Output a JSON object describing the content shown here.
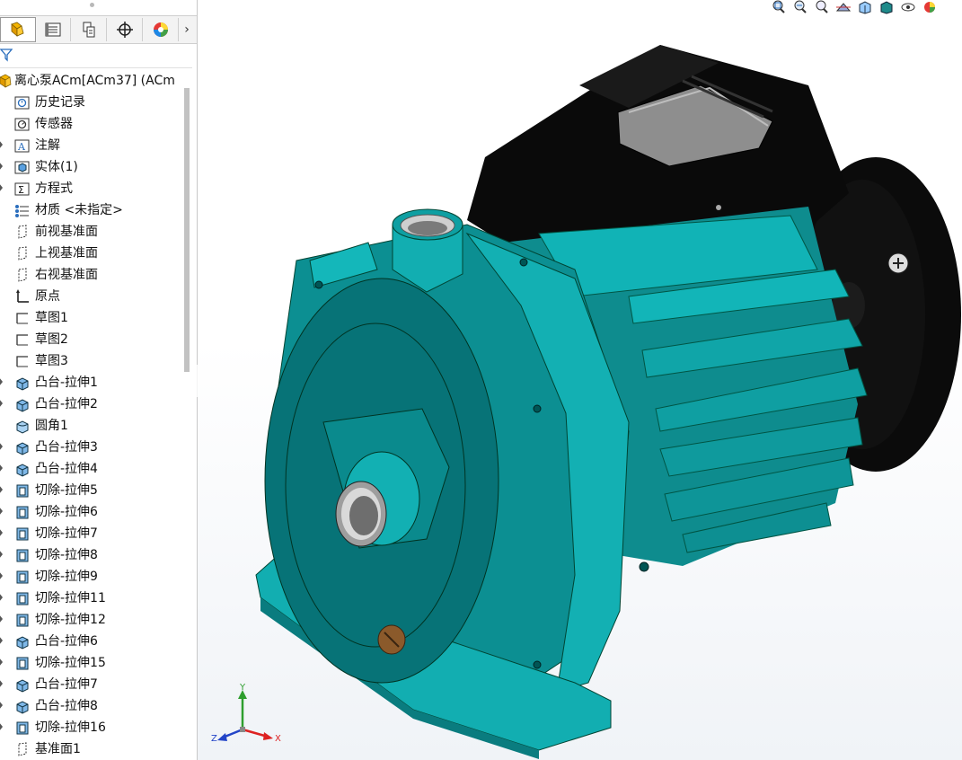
{
  "panel": {
    "tabs": [
      {
        "name": "feature-manager-tab",
        "icon": "feature-tree-icon"
      },
      {
        "name": "property-manager-tab",
        "icon": "property-manager-icon"
      },
      {
        "name": "configuration-manager-tab",
        "icon": "configuration-icon"
      },
      {
        "name": "dimxpert-tab",
        "icon": "crosshair-icon"
      },
      {
        "name": "display-manager-tab",
        "icon": "appearance-wheel-icon"
      }
    ],
    "more_glyph": "›",
    "root": {
      "label": "离心泵ACm[ACm37] (ACm",
      "icon": "part-icon"
    },
    "items": [
      {
        "label": "历史记录",
        "icon": "history-icon",
        "expandable": false
      },
      {
        "label": "传感器",
        "icon": "sensor-icon",
        "expandable": false
      },
      {
        "label": "注解",
        "icon": "annotation-icon",
        "expandable": true
      },
      {
        "label": "实体(1)",
        "icon": "solid-body-icon",
        "expandable": true
      },
      {
        "label": "方程式",
        "icon": "equation-icon",
        "expandable": true
      },
      {
        "label": "材质 <未指定>",
        "icon": "material-icon",
        "expandable": false
      },
      {
        "label": "前视基准面",
        "icon": "plane-icon",
        "expandable": false
      },
      {
        "label": "上视基准面",
        "icon": "plane-icon",
        "expandable": false
      },
      {
        "label": "右视基准面",
        "icon": "plane-icon",
        "expandable": false
      },
      {
        "label": "原点",
        "icon": "origin-icon",
        "expandable": false
      },
      {
        "label": "草图1",
        "icon": "sketch-icon",
        "expandable": false
      },
      {
        "label": "草图2",
        "icon": "sketch-icon",
        "expandable": false
      },
      {
        "label": "草图3",
        "icon": "sketch-icon",
        "expandable": false
      },
      {
        "label": "凸台-拉伸1",
        "icon": "boss-extrude-icon",
        "expandable": true
      },
      {
        "label": "凸台-拉伸2",
        "icon": "boss-extrude-icon",
        "expandable": true
      },
      {
        "label": "圆角1",
        "icon": "fillet-icon",
        "expandable": false
      },
      {
        "label": "凸台-拉伸3",
        "icon": "boss-extrude-icon",
        "expandable": true
      },
      {
        "label": "凸台-拉伸4",
        "icon": "boss-extrude-icon",
        "expandable": true
      },
      {
        "label": "切除-拉伸5",
        "icon": "cut-extrude-icon",
        "expandable": true
      },
      {
        "label": "切除-拉伸6",
        "icon": "cut-extrude-icon",
        "expandable": true
      },
      {
        "label": "切除-拉伸7",
        "icon": "cut-extrude-icon",
        "expandable": true
      },
      {
        "label": "切除-拉伸8",
        "icon": "cut-extrude-icon",
        "expandable": true
      },
      {
        "label": "切除-拉伸9",
        "icon": "cut-extrude-icon",
        "expandable": true
      },
      {
        "label": "切除-拉伸11",
        "icon": "cut-extrude-icon",
        "expandable": true
      },
      {
        "label": "切除-拉伸12",
        "icon": "cut-extrude-icon",
        "expandable": true
      },
      {
        "label": "凸台-拉伸6",
        "icon": "boss-extrude-icon",
        "expandable": true
      },
      {
        "label": "切除-拉伸15",
        "icon": "cut-extrude-icon",
        "expandable": true
      },
      {
        "label": "凸台-拉伸7",
        "icon": "boss-extrude-icon",
        "expandable": true
      },
      {
        "label": "凸台-拉伸8",
        "icon": "boss-extrude-icon",
        "expandable": true
      },
      {
        "label": "切除-拉伸16",
        "icon": "cut-extrude-icon",
        "expandable": true
      },
      {
        "label": "基准面1",
        "icon": "plane-icon",
        "expandable": false
      }
    ]
  },
  "headsup_toolbar": [
    {
      "name": "zoom-to-fit-button",
      "icon": "zoom-fit-icon"
    },
    {
      "name": "zoom-to-area-button",
      "icon": "zoom-area-icon"
    },
    {
      "name": "previous-view-button",
      "icon": "previous-view-icon"
    },
    {
      "name": "section-view-button",
      "icon": "section-view-icon"
    },
    {
      "name": "view-orientation-button",
      "icon": "view-orientation-icon"
    },
    {
      "name": "display-style-button",
      "icon": "display-style-icon"
    },
    {
      "name": "hide-show-items-button",
      "icon": "hide-show-icon"
    },
    {
      "name": "edit-appearance-button",
      "icon": "appearance-icon"
    }
  ],
  "triad": {
    "y": "Y",
    "z": "Z",
    "x": "X"
  },
  "colors": {
    "teal_face": "#087377",
    "teal_light": "#11b0b3",
    "motor_black": "#0b0b0b",
    "accent_blue": "#2a6ebd"
  }
}
